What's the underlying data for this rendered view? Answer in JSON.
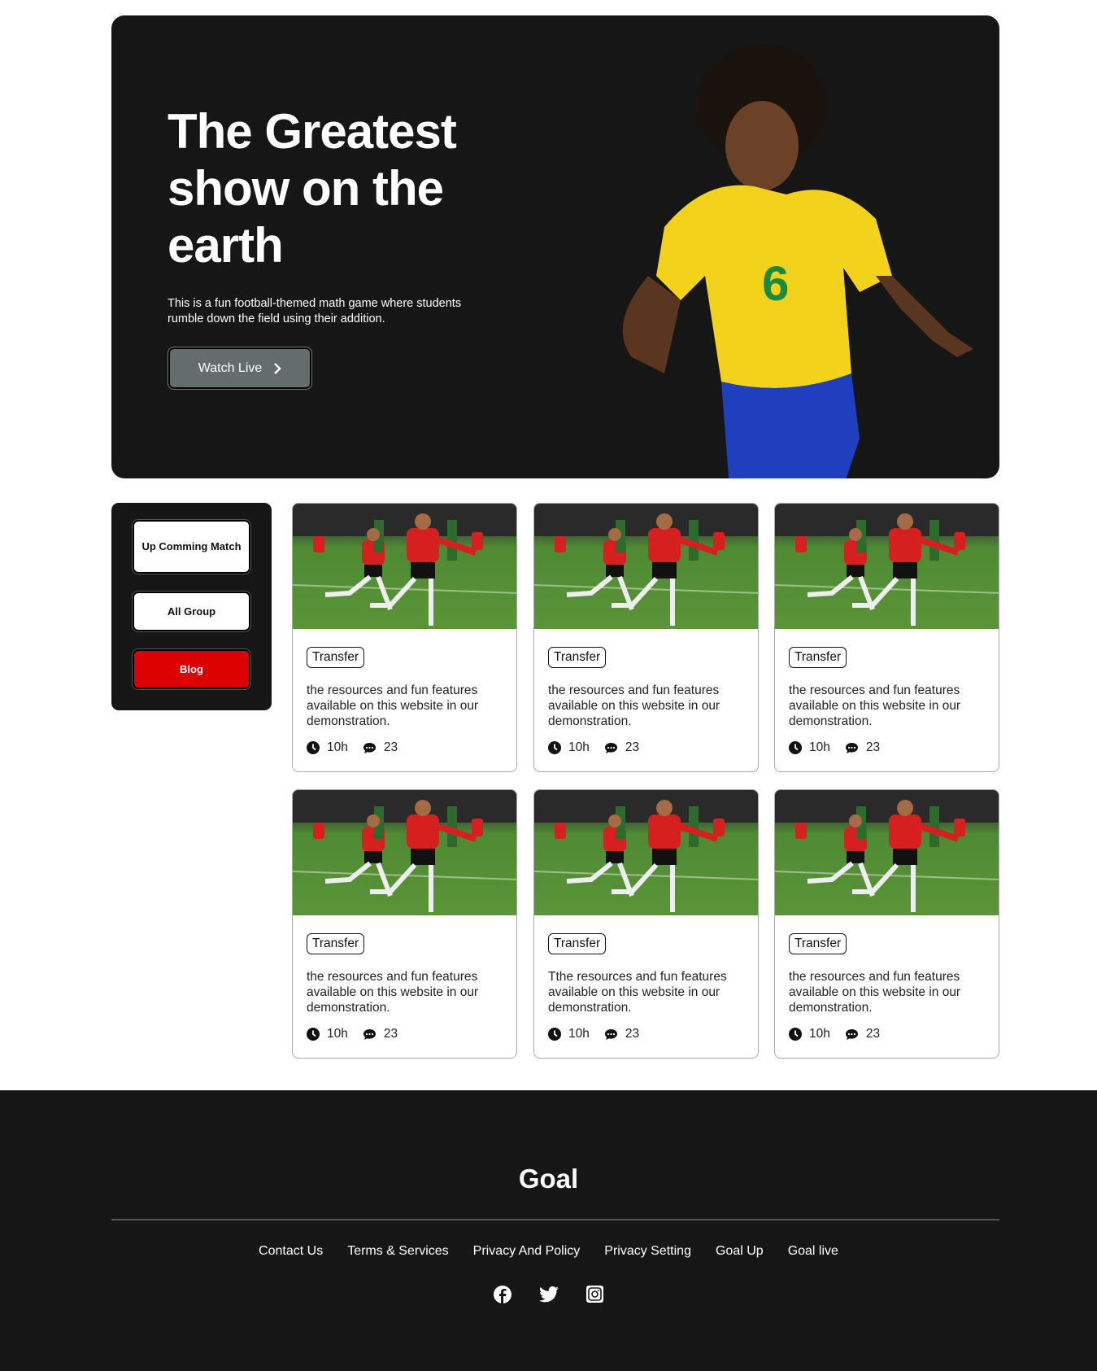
{
  "hero": {
    "title": "The Greatest show on the earth",
    "description": "This is a fun football-themed math game where students rumble down the field using their addition.",
    "cta_label": "Watch Live",
    "player_number": "6"
  },
  "sidebar": {
    "items": [
      {
        "label": "Up Comming Match"
      },
      {
        "label": "All Group"
      },
      {
        "label": "Blog"
      }
    ]
  },
  "cards": [
    {
      "tag": "Transfer",
      "text": "the resources and fun features available on this website in our demonstration.",
      "time": "10h",
      "comments": "23"
    },
    {
      "tag": "Transfer",
      "text": "the resources and fun features available on this website in our demonstration.",
      "time": "10h",
      "comments": "23"
    },
    {
      "tag": "Transfer",
      "text": "the resources and fun features available on this website in our demonstration.",
      "time": "10h",
      "comments": "23"
    },
    {
      "tag": "Transfer",
      "text": "the resources and fun features available on this website in our demonstration.",
      "time": "10h",
      "comments": "23"
    },
    {
      "tag": "Transfer",
      "text": "Tthe resources and fun features available on this website in our demonstration.",
      "time": "10h",
      "comments": "23"
    },
    {
      "tag": "Transfer",
      "text": "the resources and fun features available on this website in our demonstration.",
      "time": "10h",
      "comments": "23"
    }
  ],
  "footer": {
    "logo": "Goal",
    "links": [
      "Contact Us",
      "Terms & Services",
      "Privacy And Policy",
      "Privacy Setting",
      "Goal Up",
      "Goal live"
    ],
    "social": [
      "facebook-icon",
      "twitter-icon",
      "instagram-icon"
    ]
  },
  "colors": {
    "dark": "#161616",
    "accent": "#dd0000",
    "button": "#646d6c"
  }
}
